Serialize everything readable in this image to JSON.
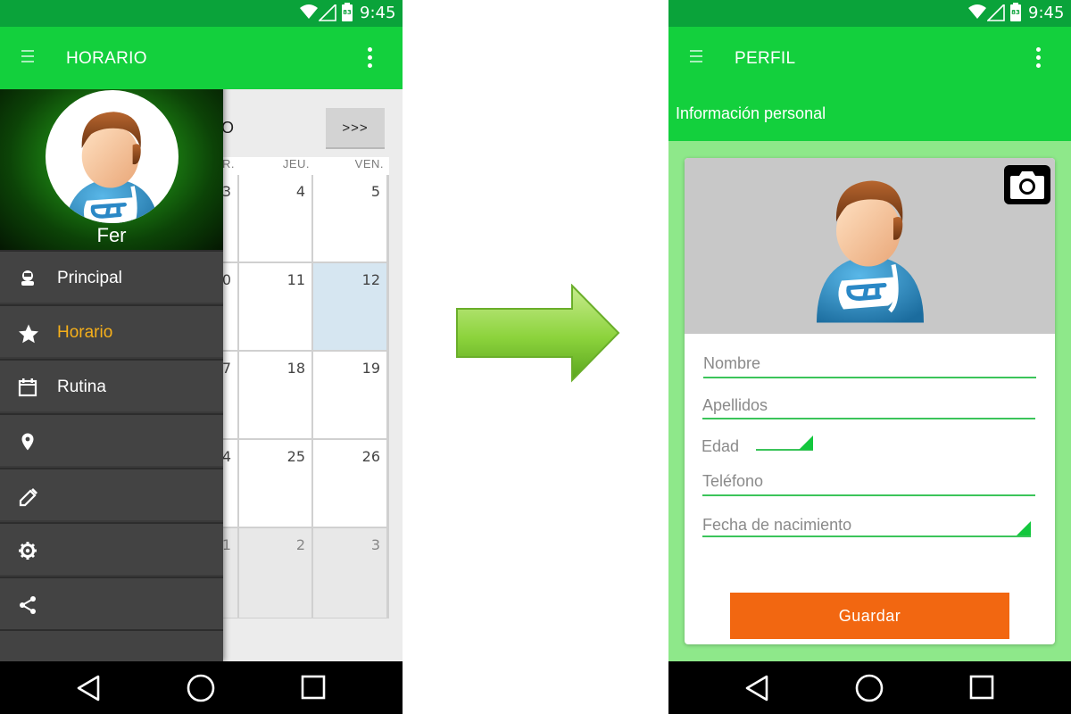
{
  "left_screen": {
    "status_time": "9:45",
    "battery_level": "83",
    "toolbar": {
      "title": "HORARIO"
    },
    "calendar": {
      "month_label": "O",
      "next_button": ">>>",
      "day_headers": [
        "R.",
        "JEU.",
        "VEN."
      ],
      "rows": [
        [
          "3",
          "4",
          "5"
        ],
        [
          "0",
          "11",
          "12"
        ],
        [
          "7",
          "18",
          "19"
        ],
        [
          "4",
          "25",
          "26"
        ],
        [
          "1",
          "2",
          "3"
        ]
      ],
      "today": "12"
    },
    "drawer": {
      "user_name": "Fer",
      "items": [
        {
          "label": "Principal",
          "icon": "person-icon"
        },
        {
          "label": "Horario",
          "icon": "star-icon",
          "active": true
        },
        {
          "label": "Rutina",
          "icon": "calendar-icon"
        },
        {
          "label": "",
          "icon": "location-icon"
        },
        {
          "label": "",
          "icon": "edit-icon"
        },
        {
          "label": "",
          "icon": "settings-icon"
        },
        {
          "label": "",
          "icon": "share-icon"
        }
      ]
    }
  },
  "right_screen": {
    "status_time": "9:45",
    "battery_level": "83",
    "toolbar": {
      "title": "PERFIL"
    },
    "section_title": "Información personal",
    "form": {
      "nombre": "Nombre",
      "apellidos": "Apellidos",
      "edad": "Edad",
      "telefono": "Teléfono",
      "fecha": "Fecha de nacimiento",
      "save_label": "Guardar"
    }
  },
  "colors": {
    "toolbar_green": "#13d03d",
    "status_green": "#0aa33a",
    "accent_orange": "#f26711",
    "active_item": "#f7b01a"
  }
}
